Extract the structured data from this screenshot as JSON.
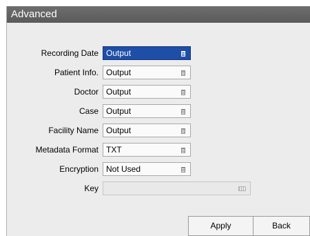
{
  "window": {
    "title": "Advanced"
  },
  "rows": [
    {
      "label": "Recording Date",
      "value": "Output",
      "icon": "list-icon"
    },
    {
      "label": "Patient Info.",
      "value": "Output",
      "icon": "list-icon"
    },
    {
      "label": "Doctor",
      "value": "Output",
      "icon": "list-icon"
    },
    {
      "label": "Case",
      "value": "Output",
      "icon": "list-icon"
    },
    {
      "label": "Facility Name",
      "value": "Output",
      "icon": "list-icon"
    },
    {
      "label": "Metadata Format",
      "value": "TXT",
      "icon": "list-icon"
    },
    {
      "label": "Encryption",
      "value": "Not Used",
      "icon": "list-icon"
    },
    {
      "label": "Key",
      "value": "",
      "icon": "keyboard-icon"
    }
  ],
  "buttons": {
    "apply": "Apply",
    "back": "Back"
  },
  "colors": {
    "selected": "#1f4ea8",
    "titlebar": "#5a5a5a"
  }
}
